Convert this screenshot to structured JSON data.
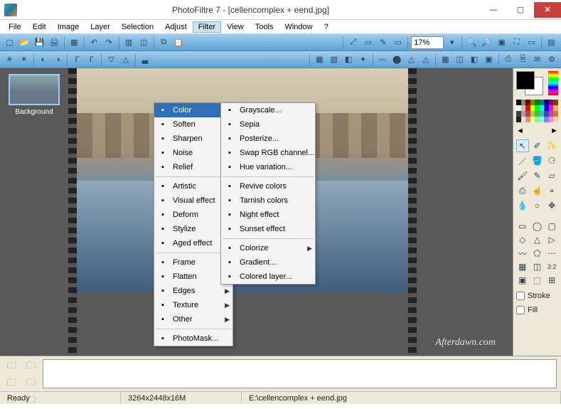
{
  "title": "PhotoFiltre 7 - [cellencomplex + eend.jpg]",
  "window_buttons": {
    "min": "—",
    "max": "▢",
    "close": "✕"
  },
  "menubar": [
    "File",
    "Edit",
    "Image",
    "Layer",
    "Selection",
    "Adjust",
    "Filter",
    "View",
    "Tools",
    "Window",
    "?"
  ],
  "menubar_open_index": 6,
  "zoom_value": "17%",
  "layer": {
    "label": "Background"
  },
  "watermark": "Afterdawn.com",
  "filter_menu": {
    "groups": [
      [
        {
          "label": "Color",
          "submenu": true,
          "highlight": true,
          "icon": "color"
        },
        {
          "label": "Soften",
          "submenu": true,
          "icon": "soften"
        },
        {
          "label": "Sharpen",
          "submenu": true,
          "icon": "sharpen"
        },
        {
          "label": "Noise",
          "submenu": true,
          "icon": "noise"
        },
        {
          "label": "Relief",
          "submenu": true,
          "icon": "relief"
        }
      ],
      [
        {
          "label": "Artistic",
          "submenu": true,
          "icon": "artistic"
        },
        {
          "label": "Visual effect",
          "submenu": true,
          "icon": "visual"
        },
        {
          "label": "Deform",
          "submenu": true,
          "icon": "deform"
        },
        {
          "label": "Stylize",
          "submenu": true,
          "icon": "stylize"
        },
        {
          "label": "Aged effect",
          "submenu": true,
          "icon": "aged"
        }
      ],
      [
        {
          "label": "Frame",
          "submenu": true,
          "icon": "frame"
        },
        {
          "label": "Flatten",
          "submenu": true,
          "icon": "flatten"
        },
        {
          "label": "Edges",
          "submenu": true,
          "icon": "edges"
        },
        {
          "label": "Texture",
          "submenu": true,
          "icon": "texture"
        },
        {
          "label": "Other",
          "submenu": true,
          "icon": "other"
        }
      ],
      [
        {
          "label": "PhotoMask...",
          "submenu": false,
          "icon": "photomask"
        }
      ]
    ]
  },
  "color_submenu": {
    "groups": [
      [
        {
          "label": "Grayscale...",
          "icon": "grayscale"
        },
        {
          "label": "Sepia",
          "icon": "sepia"
        },
        {
          "label": "Posterize...",
          "icon": "posterize"
        },
        {
          "label": "Swap RGB channel...",
          "icon": "swap"
        },
        {
          "label": "Hue variation...",
          "icon": "hue"
        }
      ],
      [
        {
          "label": "Revive colors",
          "icon": "revive"
        },
        {
          "label": "Tarnish colors",
          "icon": "tarnish"
        },
        {
          "label": "Night effect",
          "icon": "night"
        },
        {
          "label": "Sunset effect",
          "icon": "sunset"
        }
      ],
      [
        {
          "label": "Colorize",
          "submenu": true,
          "icon": "colorize"
        },
        {
          "label": "Gradient...",
          "icon": "gradient"
        },
        {
          "label": "Colored layer...",
          "icon": "coloredlayer"
        }
      ]
    ]
  },
  "palette_colors": [
    "#000",
    "#808080",
    "#800000",
    "#808000",
    "#008000",
    "#008080",
    "#000080",
    "#800080",
    "#804000",
    "#fff",
    "#c0c0c0",
    "#f00",
    "#ff0",
    "#0f0",
    "#0ff",
    "#00f",
    "#f0f",
    "#ffb060",
    "#404040",
    "#a0a0a0",
    "#c04040",
    "#c0c040",
    "#40c040",
    "#40c0c0",
    "#4040c0",
    "#c040c0",
    "#c08040",
    "#202020",
    "#e0e0e0",
    "#ff8080",
    "#ffff80",
    "#80ff80",
    "#80ffff",
    "#8080ff",
    "#ff80ff",
    "#ffd0a0"
  ],
  "palette_nav": {
    "prev": "◄",
    "next": "►"
  },
  "options": {
    "stroke_label": "Stroke",
    "fill_label": "Fill",
    "stroke_checked": false,
    "fill_checked": false
  },
  "status": {
    "ready": "Ready",
    "dims": "3264x2448x16M",
    "path": "E:\\cellencomplex + eend.jpg"
  }
}
